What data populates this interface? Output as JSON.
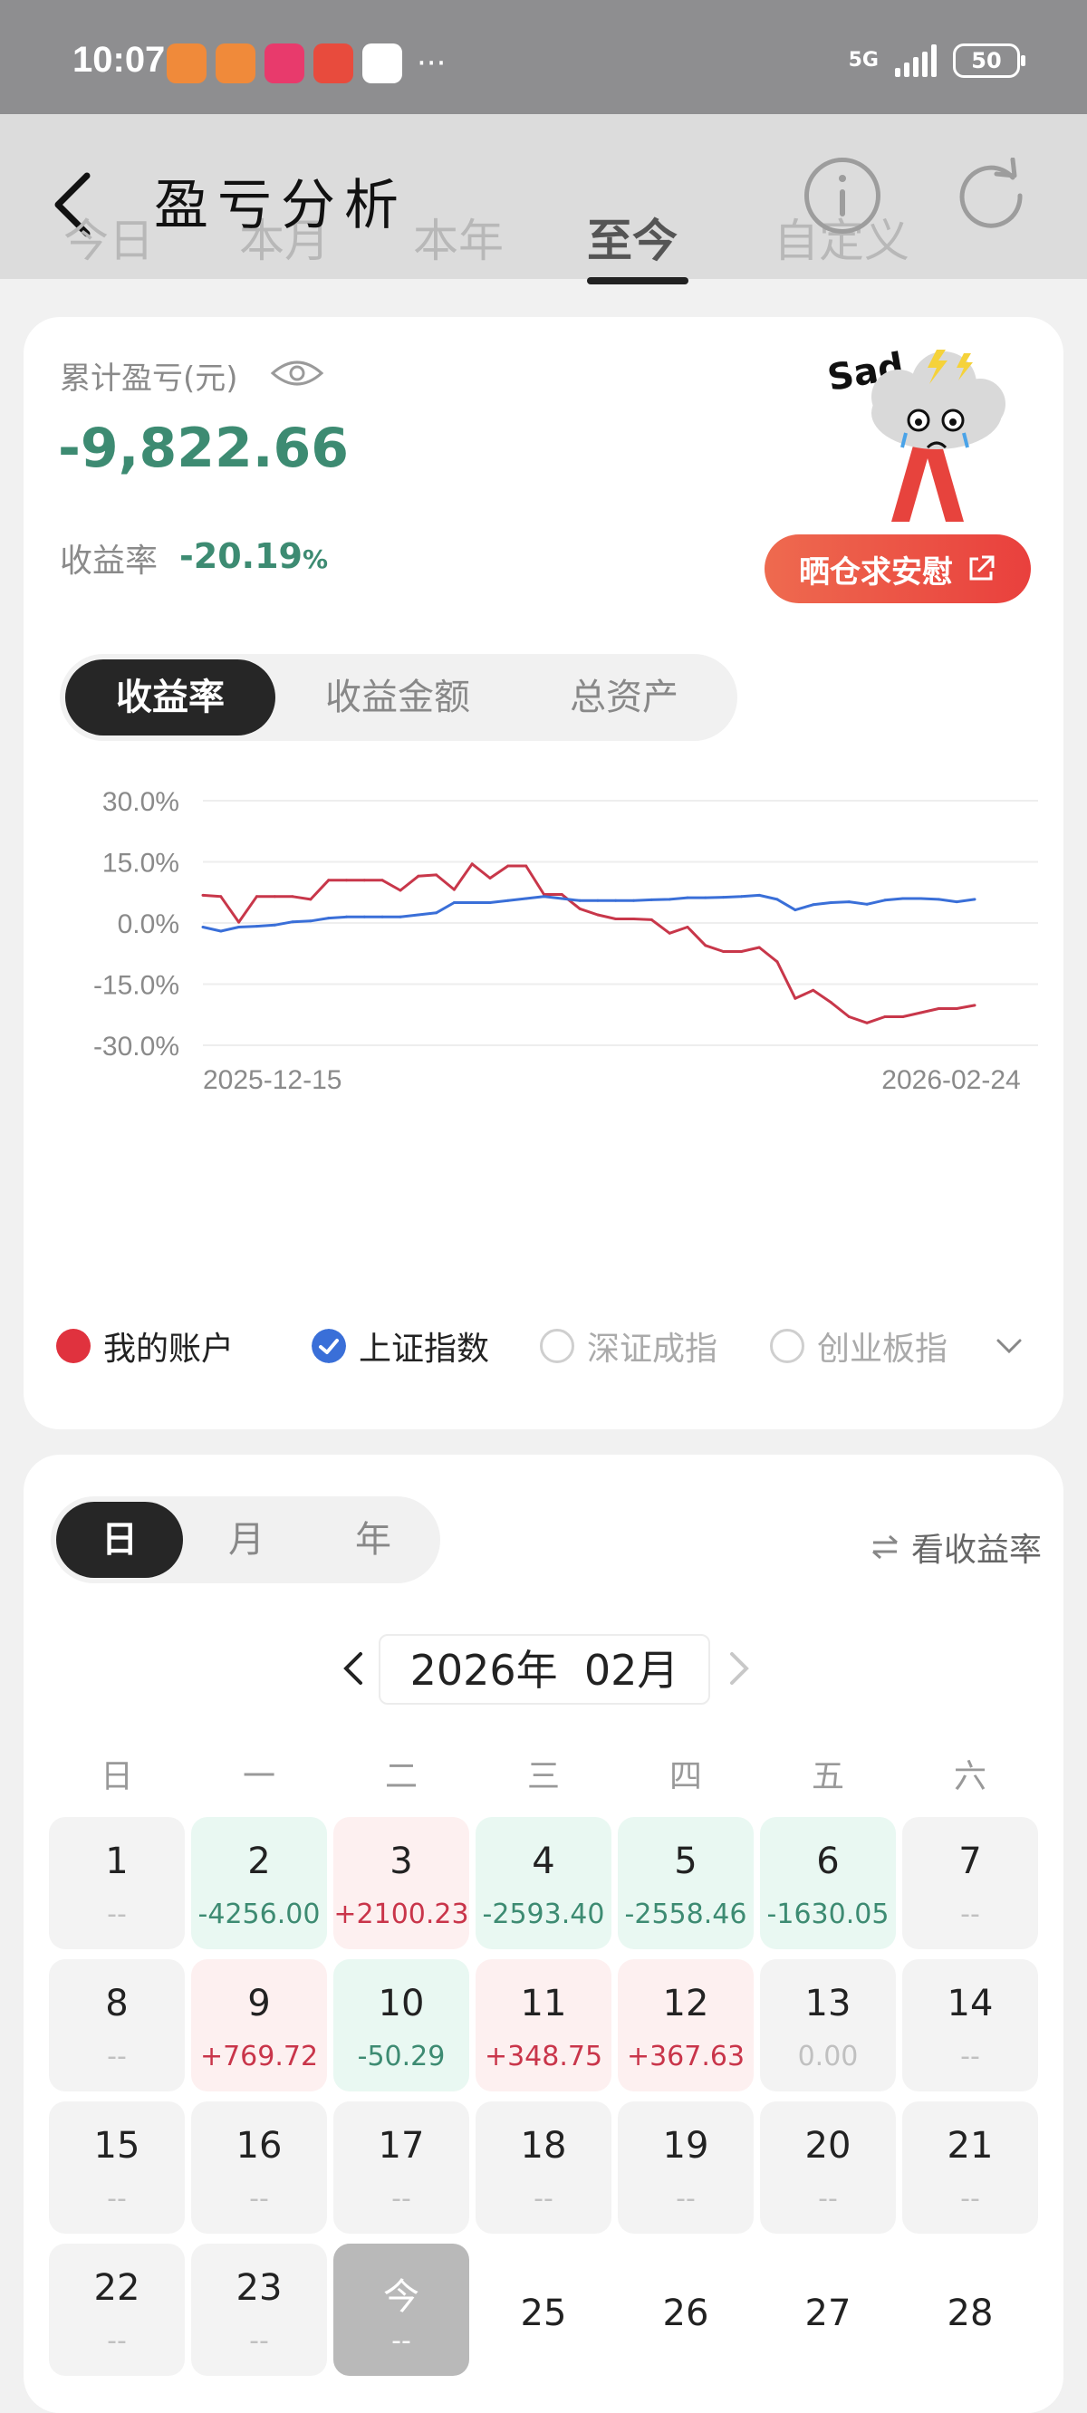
{
  "status_bar": {
    "time": "10:07",
    "network": "5G",
    "battery": "50",
    "more": "···"
  },
  "header": {
    "title": "盈亏分析",
    "tabs": [
      {
        "label": "今日",
        "active": false
      },
      {
        "label": "本月",
        "active": false
      },
      {
        "label": "本年",
        "active": false
      },
      {
        "label": "至今",
        "active": true
      },
      {
        "label": "自定义",
        "active": false
      }
    ]
  },
  "summary": {
    "cumulative_label": "累计盈亏(元)",
    "cumulative_value": "-9,822.66",
    "rate_label": "收益率",
    "rate_value": "-20.19",
    "rate_unit": "%",
    "sticker_text": "Sad",
    "share_label": "晒仓求安慰"
  },
  "metric_tabs": [
    {
      "label": "收益率",
      "active": true
    },
    {
      "label": "收益金额",
      "active": false
    },
    {
      "label": "总资产",
      "active": false
    }
  ],
  "chart_data": {
    "type": "line",
    "title": "",
    "xlabel": "",
    "ylabel": "",
    "x_ticks": [
      "2025-12-15",
      "2026-02-24"
    ],
    "y_ticks": [
      "30.0%",
      "15.0%",
      "0.0%",
      "-15.0%",
      "-30.0%"
    ],
    "ylim": [
      -30,
      30
    ],
    "x": [
      "2025-12-15",
      "2025-12-16",
      "2025-12-17",
      "2025-12-18",
      "2025-12-19",
      "2025-12-22",
      "2025-12-23",
      "2025-12-24",
      "2025-12-25",
      "2025-12-26",
      "2025-12-29",
      "2025-12-30",
      "2025-12-31",
      "2026-01-05",
      "2026-01-06",
      "2026-01-07",
      "2026-01-08",
      "2026-01-09",
      "2026-01-12",
      "2026-01-13",
      "2026-01-14",
      "2026-01-15",
      "2026-01-16",
      "2026-01-19",
      "2026-01-20",
      "2026-01-21",
      "2026-01-22",
      "2026-01-23",
      "2026-01-26",
      "2026-01-27",
      "2026-01-28",
      "2026-01-29",
      "2026-01-30",
      "2026-02-02",
      "2026-02-03",
      "2026-02-04",
      "2026-02-05",
      "2026-02-06",
      "2026-02-09",
      "2026-02-10",
      "2026-02-11",
      "2026-02-12",
      "2026-02-13",
      "2026-02-24"
    ],
    "series": [
      {
        "name": "我的账户",
        "color": "#c8374a",
        "values": [
          6.8,
          6.5,
          0.2,
          6.5,
          6.5,
          6.5,
          5.8,
          10.5,
          10.5,
          10.5,
          10.5,
          8.0,
          11.5,
          11.8,
          8.2,
          14.5,
          11.0,
          14.0,
          14.0,
          7.0,
          7.0,
          3.5,
          2.0,
          1.0,
          1.0,
          0.8,
          -2.5,
          -1.0,
          -5.5,
          -7.0,
          -7.0,
          -6.0,
          -9.5,
          -18.5,
          -16.5,
          -19.5,
          -23.0,
          -24.5,
          -23.0,
          -23.0,
          -22.0,
          -21.0,
          -21.0,
          -20.19
        ]
      },
      {
        "name": "上证指数",
        "color": "#3a6fd8",
        "values": [
          -1.0,
          -2.0,
          -1.0,
          -0.8,
          -0.5,
          0.3,
          0.5,
          1.2,
          1.5,
          1.5,
          1.5,
          1.5,
          2.0,
          2.5,
          5.0,
          5.0,
          5.0,
          5.5,
          6.0,
          6.5,
          6.0,
          5.5,
          5.5,
          5.5,
          5.5,
          5.7,
          5.8,
          6.2,
          6.2,
          6.3,
          6.5,
          6.8,
          5.8,
          3.2,
          4.5,
          5.0,
          5.2,
          4.6,
          5.6,
          6.0,
          6.0,
          5.8,
          5.2,
          5.8
        ]
      }
    ]
  },
  "legend": [
    {
      "label": "我的账户",
      "checked": true,
      "color": "#e0323e"
    },
    {
      "label": "上证指数",
      "checked": true,
      "color": "#3a6fd8"
    },
    {
      "label": "深证成指",
      "checked": false
    },
    {
      "label": "创业板指",
      "checked": false
    }
  ],
  "calendar": {
    "period_tabs": [
      {
        "label": "日",
        "active": true
      },
      {
        "label": "月",
        "active": false
      },
      {
        "label": "年",
        "active": false
      }
    ],
    "toggle_label": "看收益率",
    "month_label": "2026年  02月",
    "weekdays": [
      "日",
      "一",
      "二",
      "三",
      "四",
      "五",
      "六"
    ],
    "days": [
      {
        "day": "1",
        "value": "--",
        "type": "neutral"
      },
      {
        "day": "2",
        "value": "-4256.00",
        "type": "loss"
      },
      {
        "day": "3",
        "value": "+2100.23",
        "type": "gain"
      },
      {
        "day": "4",
        "value": "-2593.40",
        "type": "loss"
      },
      {
        "day": "5",
        "value": "-2558.46",
        "type": "loss"
      },
      {
        "day": "6",
        "value": "-1630.05",
        "type": "loss"
      },
      {
        "day": "7",
        "value": "--",
        "type": "neutral"
      },
      {
        "day": "8",
        "value": "--",
        "type": "neutral"
      },
      {
        "day": "9",
        "value": "+769.72",
        "type": "gain"
      },
      {
        "day": "10",
        "value": "-50.29",
        "type": "loss"
      },
      {
        "day": "11",
        "value": "+348.75",
        "type": "gain"
      },
      {
        "day": "12",
        "value": "+367.63",
        "type": "gain"
      },
      {
        "day": "13",
        "value": "0.00",
        "type": "neutral"
      },
      {
        "day": "14",
        "value": "--",
        "type": "neutral"
      },
      {
        "day": "15",
        "value": "--",
        "type": "neutral"
      },
      {
        "day": "16",
        "value": "--",
        "type": "neutral"
      },
      {
        "day": "17",
        "value": "--",
        "type": "neutral"
      },
      {
        "day": "18",
        "value": "--",
        "type": "neutral"
      },
      {
        "day": "19",
        "value": "--",
        "type": "neutral"
      },
      {
        "day": "20",
        "value": "--",
        "type": "neutral"
      },
      {
        "day": "21",
        "value": "--",
        "type": "neutral"
      },
      {
        "day": "22",
        "value": "--",
        "type": "neutral"
      },
      {
        "day": "23",
        "value": "--",
        "type": "neutral"
      },
      {
        "day": "今",
        "value": "--",
        "type": "today"
      },
      {
        "day": "25",
        "value": "",
        "type": "future"
      },
      {
        "day": "26",
        "value": "",
        "type": "future"
      },
      {
        "day": "27",
        "value": "",
        "type": "future"
      },
      {
        "day": "28",
        "value": "",
        "type": "future"
      }
    ]
  }
}
